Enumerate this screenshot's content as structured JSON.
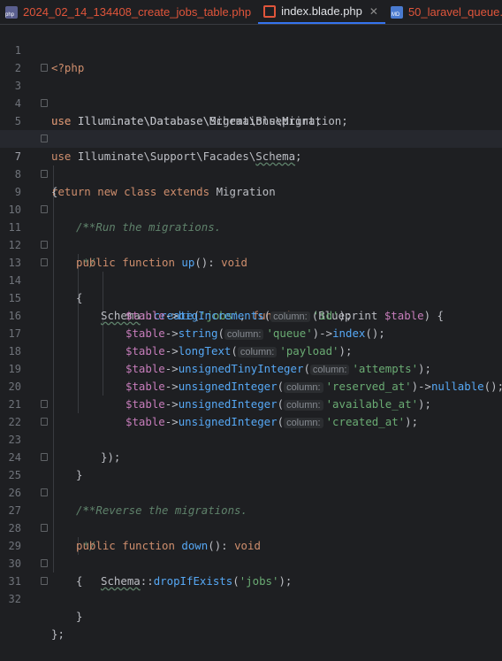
{
  "tabs": [
    {
      "label": "2024_02_14_134408_create_jobs_table.php",
      "icon": "php-file-icon",
      "color": "#e0553b",
      "active": false
    },
    {
      "label": "index.blade.php",
      "icon": "blade-file-icon",
      "color": "#dfe1e5",
      "active": true
    },
    {
      "label": "50_laravel_queue.md",
      "icon": "markdown-file-icon",
      "color": "#e0553b",
      "active": false
    }
  ],
  "colors": {
    "background": "#1e1f22",
    "keyword": "#cf8e6d",
    "string": "#6aab73",
    "function": "#56a8f5",
    "variable": "#c77dbb",
    "comment": "#5f826b",
    "accent": "#3574f0"
  },
  "code": {
    "line_numbers": [
      "1",
      "2",
      "3",
      "4",
      "5",
      "6",
      "7",
      "8",
      "9",
      "10",
      "11",
      "12",
      "13",
      "14",
      "15",
      "16",
      "17",
      "18",
      "19",
      "20",
      "21",
      "22",
      "23",
      "24",
      "25",
      "26",
      "27",
      "28",
      "29",
      "30",
      "31",
      "32"
    ],
    "current_line": "7",
    "l1": {
      "open": "<?php"
    },
    "l3": {
      "use": "use",
      "path": "Illuminate\\Database\\Migrations\\",
      "cls": "Migration",
      "end": ";"
    },
    "l4": {
      "use": "use",
      "path": "Illuminate\\Database\\Schema\\",
      "cls": "Blueprint",
      "end": ";"
    },
    "l5": {
      "use": "use",
      "path": "Illuminate\\Support\\Facades\\",
      "cls": "Schema",
      "end": ";"
    },
    "l7": {
      "k1": "return",
      "k2": "new",
      "k3": "class",
      "k4": "extends",
      "cls": "Migration"
    },
    "l8": {
      "t": "{"
    },
    "l9": {
      "t": "/**"
    },
    "l10": {
      "t": " * Run the migrations."
    },
    "l11": {
      "t": " */"
    },
    "l12": {
      "k1": "public",
      "k2": "function",
      "fn": "up",
      "rest": "(): ",
      "ret": "void"
    },
    "l13": {
      "t": "{"
    },
    "l14": {
      "cls": "Schema",
      "sep": "::",
      "fn": "create",
      "p1": "(",
      "s1": "'jobs'",
      "c1": ", ",
      "k": "function",
      "p2": " (",
      "cls2": "Blueprint",
      "var": "$table",
      "p3": ") {"
    },
    "l15": {
      "var": "$table",
      "arrow": "->",
      "fn": "bigIncrements",
      "open": "(",
      "hint": "column:",
      "str": "'id'",
      "close": ");"
    },
    "l16": {
      "var": "$table",
      "arrow": "->",
      "fn": "string",
      "open": "(",
      "hint": "column:",
      "str": "'queue'",
      "mid": ")->",
      "fn2": "index",
      "close": "();"
    },
    "l17": {
      "var": "$table",
      "arrow": "->",
      "fn": "longText",
      "open": "(",
      "hint": "column:",
      "str": "'payload'",
      "close": ");"
    },
    "l18": {
      "var": "$table",
      "arrow": "->",
      "fn": "unsignedTinyInteger",
      "open": "(",
      "hint": "column:",
      "str": "'attempts'",
      "close": ");"
    },
    "l19": {
      "var": "$table",
      "arrow": "->",
      "fn": "unsignedInteger",
      "open": "(",
      "hint": "column:",
      "str": "'reserved_at'",
      "mid": ")->",
      "fn2": "nullable",
      "close": "();"
    },
    "l20": {
      "var": "$table",
      "arrow": "->",
      "fn": "unsignedInteger",
      "open": "(",
      "hint": "column:",
      "str": "'available_at'",
      "close": ");"
    },
    "l21": {
      "var": "$table",
      "arrow": "->",
      "fn": "unsignedInteger",
      "open": "(",
      "hint": "column:",
      "str": "'created_at'",
      "close": ");"
    },
    "l22": {
      "t": "});"
    },
    "l23": {
      "t": "}"
    },
    "l25": {
      "t": "/**"
    },
    "l26": {
      "t": " * Reverse the migrations."
    },
    "l27": {
      "t": " */"
    },
    "l28": {
      "k1": "public",
      "k2": "function",
      "fn": "down",
      "rest": "(): ",
      "ret": "void"
    },
    "l29": {
      "t": "{"
    },
    "l30": {
      "cls": "Schema",
      "sep": "::",
      "fn": "dropIfExists",
      "p1": "(",
      "s1": "'jobs'",
      "close": ");"
    },
    "l31": {
      "t": "}"
    },
    "l32": {
      "t": "};"
    }
  }
}
